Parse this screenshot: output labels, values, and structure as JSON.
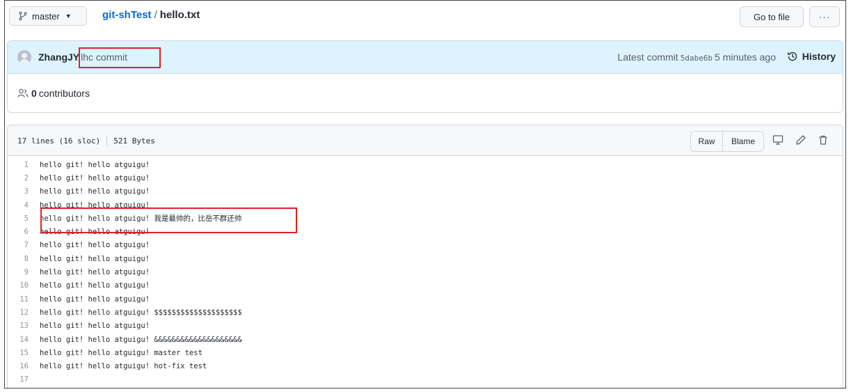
{
  "header": {
    "branch": "master",
    "repo": "git-shTest",
    "separator": "/",
    "file": "hello.txt",
    "goto_label": "Go to file",
    "more_label": "···"
  },
  "commit": {
    "author": "ZhangJY",
    "message": "lhc commit",
    "latest_label": "Latest commit",
    "sha": "5dabe6b",
    "time": "5 minutes ago",
    "history_label": "History"
  },
  "contributors": {
    "count": "0",
    "label": "contributors"
  },
  "file": {
    "lines_info": "17 lines (16 sloc)",
    "size": "521 Bytes",
    "raw_label": "Raw",
    "blame_label": "Blame"
  },
  "code": [
    {
      "n": "1",
      "text": "hello git! hello atguigu!"
    },
    {
      "n": "2",
      "text": "hello git! hello atguigu!"
    },
    {
      "n": "3",
      "text": "hello git! hello atguigu!"
    },
    {
      "n": "4",
      "text": "hello git! hello atguigu!"
    },
    {
      "n": "5",
      "text": "hello git! hello atguigu! 我是最帅的，比岳不群还帅"
    },
    {
      "n": "6",
      "text": "hello git! hello atguigu!"
    },
    {
      "n": "7",
      "text": "hello git! hello atguigu!"
    },
    {
      "n": "8",
      "text": "hello git! hello atguigu!"
    },
    {
      "n": "9",
      "text": "hello git! hello atguigu!"
    },
    {
      "n": "10",
      "text": "hello git! hello atguigu!"
    },
    {
      "n": "11",
      "text": "hello git! hello atguigu!"
    },
    {
      "n": "12",
      "text": "hello git! hello atguigu! $$$$$$$$$$$$$$$$$$$$"
    },
    {
      "n": "13",
      "text": "hello git! hello atguigu!"
    },
    {
      "n": "14",
      "text": "hello git! hello atguigu! &&&&&&&&&&&&&&&&&&&&"
    },
    {
      "n": "15",
      "text": "hello git! hello atguigu! master test"
    },
    {
      "n": "16",
      "text": "hello git! hello atguigu! hot-fix test"
    },
    {
      "n": "17",
      "text": ""
    }
  ],
  "colors": {
    "accent": "#0969da",
    "highlight": "#e02020",
    "commit_bg": "#ddf4ff"
  }
}
